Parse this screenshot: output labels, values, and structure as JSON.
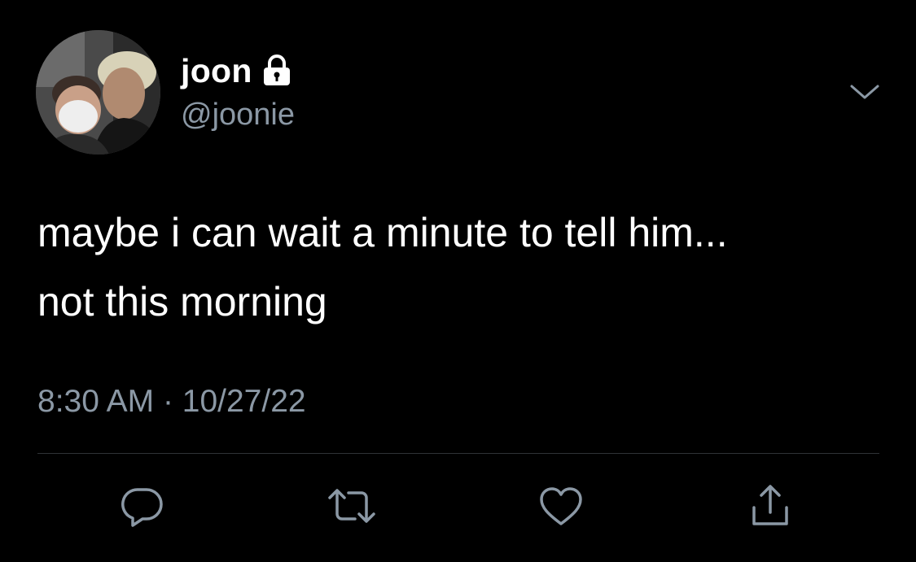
{
  "tweet": {
    "author": {
      "display_name": "joon",
      "handle": "@joonie",
      "protected_icon": "lock-icon",
      "avatar": "profile-photo"
    },
    "menu_icon": "chevron-down-icon",
    "text_lines": [
      "maybe i can wait a minute to tell him...",
      "not this morning"
    ],
    "time": "8:30 AM",
    "separator": "·",
    "date": "10/27/22",
    "actions": [
      {
        "name": "reply",
        "icon": "reply-icon"
      },
      {
        "name": "retweet",
        "icon": "retweet-icon"
      },
      {
        "name": "like",
        "icon": "heart-icon"
      },
      {
        "name": "share",
        "icon": "share-icon"
      }
    ]
  },
  "colors": {
    "background": "#000000",
    "primary_text": "#ffffff",
    "secondary_text": "#8b98a5",
    "divider": "#2f3336"
  }
}
